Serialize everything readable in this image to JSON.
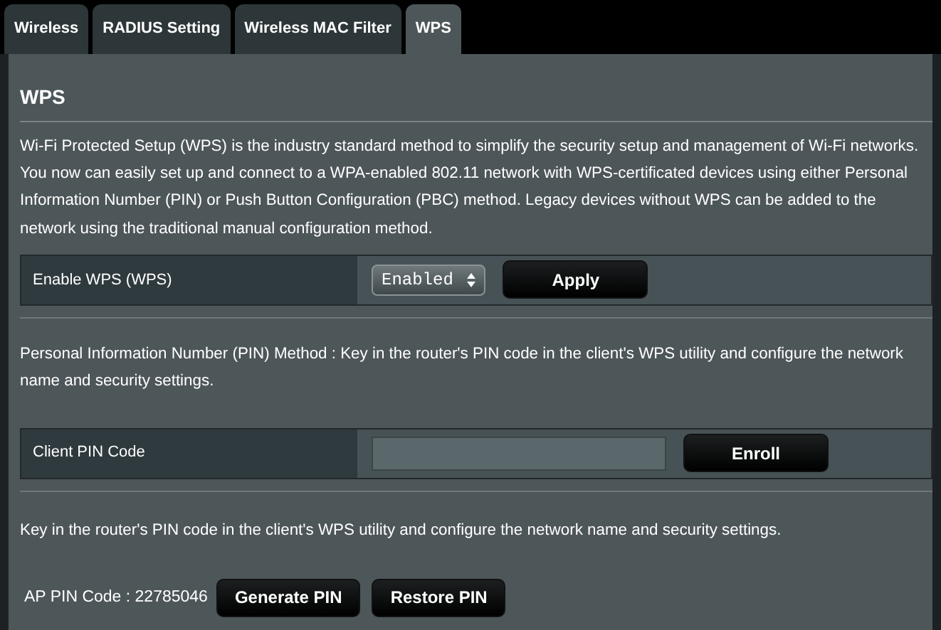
{
  "tabs": [
    {
      "label": "Wireless",
      "selected": false
    },
    {
      "label": "RADIUS Setting",
      "selected": false
    },
    {
      "label": "Wireless MAC Filter",
      "selected": false
    },
    {
      "label": "WPS",
      "selected": true
    }
  ],
  "heading": "WPS",
  "description": "Wi-Fi Protected Setup (WPS) is the industry standard method to simplify the security setup and management of Wi-Fi networks. You now can easily set up and connect to a WPA-enabled 802.11 network with WPS-certificated devices using either Personal Information Number (PIN) or Push Button Configuration (PBC) method. Legacy devices without WPS can be added to the network using the traditional manual configuration method.",
  "enable_row": {
    "label": "Enable WPS (WPS)",
    "select_value": "Enabled",
    "button": "Apply"
  },
  "pin_method_text": "Personal Information Number (PIN) Method : Key in the router's PIN code in the client's WPS utility and configure the network name and security settings.",
  "client_pin_row": {
    "label": "Client PIN Code",
    "button": "Enroll"
  },
  "router_pin_text": "Key in the router's PIN code in the client's WPS utility and configure the network name and security settings.",
  "ap_pin": {
    "label": "AP PIN Code : 22785046",
    "buttons": [
      "Generate PIN",
      "Restore PIN"
    ]
  }
}
